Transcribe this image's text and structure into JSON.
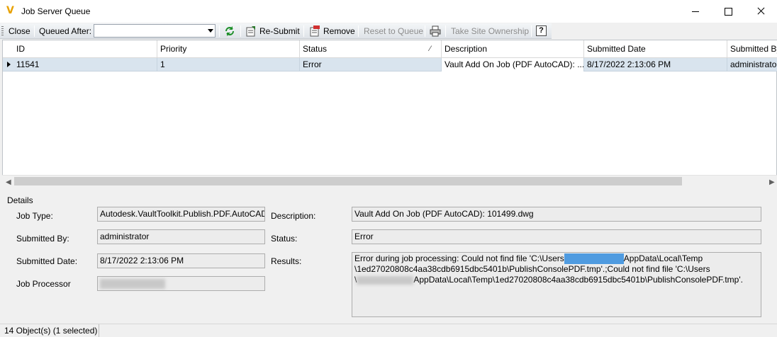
{
  "window": {
    "title": "Job Server Queue",
    "logo_letter": "V",
    "accent": "#e8a100"
  },
  "toolbar": {
    "close_label": "Close",
    "queued_after_label": "Queued After:",
    "queued_after_value": "",
    "refresh_icon": "refresh-icon",
    "resubmit_label": "Re-Submit",
    "remove_label": "Remove",
    "reset_label": "Reset to Queue",
    "take_ownership_label": "Take Site Ownership",
    "help_label": "?"
  },
  "grid": {
    "columns": [
      "ID",
      "Priority",
      "Status",
      "Description",
      "Submitted Date",
      "Submitted By"
    ],
    "rows": [
      {
        "id": "11541",
        "priority": "1",
        "status": "Error",
        "description": "Vault Add On Job (PDF AutoCAD): ...",
        "submitted_date": "8/17/2022 2:13:06 PM",
        "submitted_by": "administrator"
      }
    ]
  },
  "details": {
    "section_label": "Details",
    "job_type_label": "Job Type:",
    "job_type_value": "Autodesk.VaultToolkit.Publish.PDF.AutoCAD",
    "submitted_by_label": "Submitted By:",
    "submitted_by_value": "administrator",
    "submitted_date_label": "Submitted Date:",
    "submitted_date_value": "8/17/2022 2:13:06 PM",
    "job_processor_label": "Job Processor",
    "description_label": "Description:",
    "description_value": "Vault Add On Job (PDF AutoCAD): 101499.dwg",
    "status_label": "Status:",
    "status_value": "Error",
    "results_label": "Results:",
    "results_part1": "Error during job processing: Could not find file 'C:\\Users",
    "results_part2": "AppData\\Local\\Temp",
    "results_part3": "\\1ed27020808c4aa38cdb6915dbc5401b\\PublishConsolePDF.tmp'.;Could not find file 'C:\\Users",
    "results_part4": "\\",
    "results_part5": "AppData\\Local\\Temp\\1ed27020808c4aa38cdb6915dbc5401b\\PublishConsolePDF.tmp'."
  },
  "status_bar": {
    "text": "14 Object(s) (1 selected)"
  }
}
